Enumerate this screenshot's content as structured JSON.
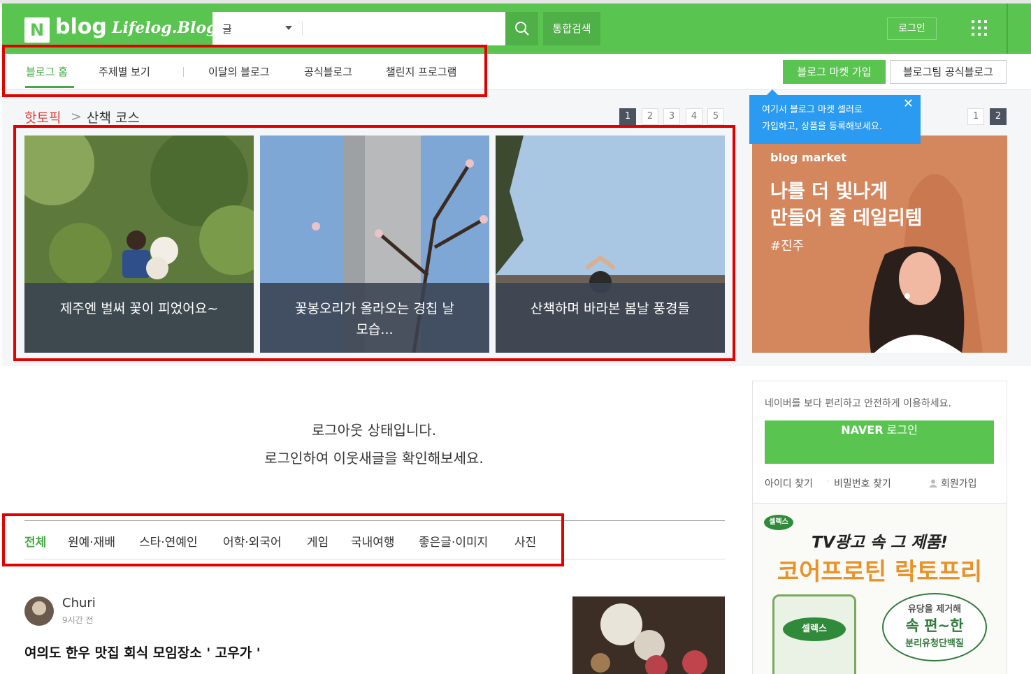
{
  "header": {
    "logo_n": "N",
    "logo_blog": "blog",
    "logo_sub": "Lifelog.Blog",
    "search": {
      "category": "글",
      "value": "",
      "placeholder": ""
    },
    "total_search": "통합검색",
    "login": "로그인"
  },
  "gnb": {
    "items": [
      "블로그 홈",
      "주제별 보기",
      "이달의 블로그",
      "공식블로그",
      "챌린지 프로그램"
    ],
    "market_join": "블로그 마켓 가입",
    "official_blog": "블로그팀 공식블로그"
  },
  "hot": {
    "label": "핫토픽",
    "chevron": ">",
    "topic": "산책 코스",
    "pages": [
      "1",
      "2",
      "3",
      "4",
      "5"
    ],
    "cards": [
      {
        "caption": "제주엔 벌써 꽃이 피었어요~"
      },
      {
        "caption": "꽃봉오리가 올라오는 경칩 날 모습..."
      },
      {
        "caption": "산책하며 바라본 봄날 풍경들"
      }
    ]
  },
  "tooltip": {
    "text1": "여기서 블로그 마켓 셀러로",
    "text2": "가입하고, 상품을 등록해보세요.",
    "close": "✕"
  },
  "ad_pages": [
    "1",
    "2"
  ],
  "ad": {
    "brand": "blog market",
    "line1": "나를 더 빛나게",
    "line2": "만들어 줄 데일리템",
    "tag": "#진주"
  },
  "logout": {
    "line1": "로그아웃 상태입니다.",
    "line2": "로그인하여 이웃새글을 확인해보세요."
  },
  "login_box": {
    "desc": "네이버를 보다 편리하고 안전하게 이용하세요.",
    "naver": "NAVER",
    "login": "로그인",
    "find_id": "아이디 찾기",
    "sep": "·",
    "find_pw": "비밀번호 찾기",
    "signup": "회원가입"
  },
  "ad2": {
    "brand": "셀렉스",
    "title": "TV광고 속 그 제품!",
    "product": "코어프로틴 락토프리",
    "bubble1": "유당을 제거해",
    "bubble2": "속 편~한",
    "bubble3": "분리유청단백질",
    "can_label": "셀렉스"
  },
  "categories": [
    "전체",
    "원예·재배",
    "스타·연예인",
    "어학·외국어",
    "게임",
    "국내여행",
    "좋은글·이미지",
    "사진"
  ],
  "post": {
    "author": "Churi",
    "time": "9시간 전",
    "title": "여의도 한우 맛집 회식 모임장소 ' 고우가 '"
  },
  "colors": {
    "brand_green": "#5ac451",
    "hot_red": "#e0413b",
    "annotation_red": "#e50000",
    "tooltip_blue": "#2a9bf0"
  }
}
